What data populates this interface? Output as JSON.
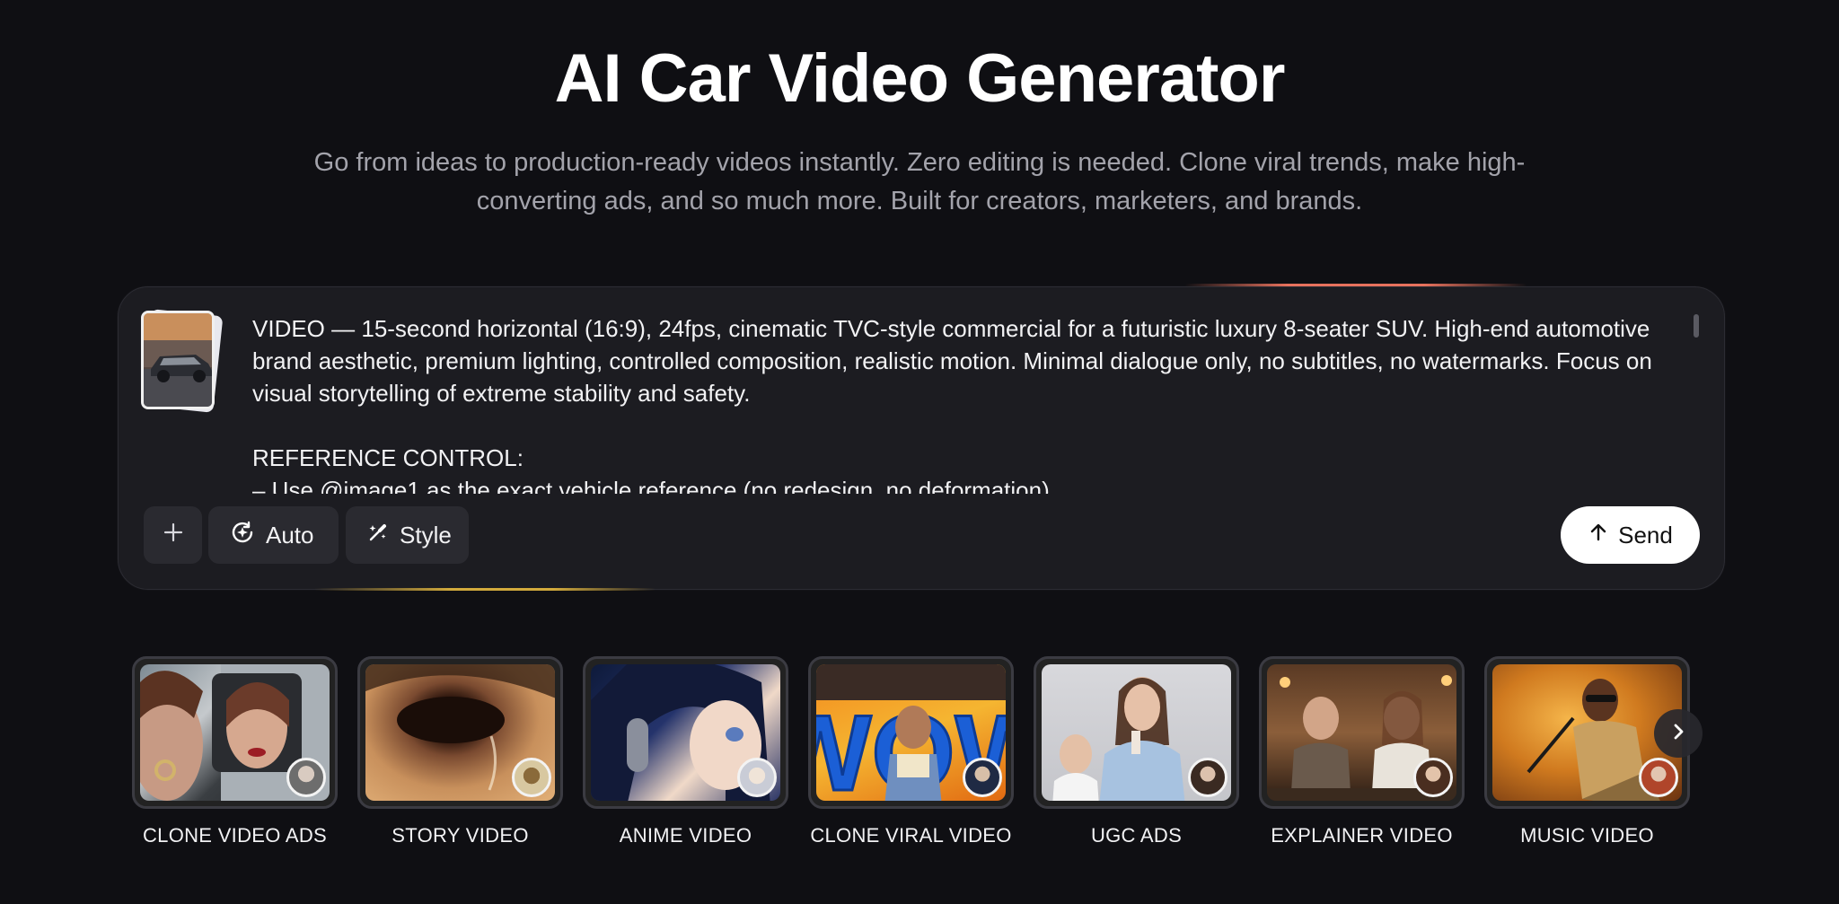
{
  "hero": {
    "title": "AI Car Video Generator",
    "subtitle": "Go from ideas to production-ready videos instantly. Zero editing is needed. Clone viral trends, make high-converting ads, and so much more. Built for creators, marketers, and brands."
  },
  "prompt": {
    "text": "VIDEO — 15-second horizontal (16:9), 24fps, cinematic TVC-style commercial for a futuristic luxury 8-seater SUV. High-end automotive brand aesthetic, premium lighting, controlled composition, realistic motion. Minimal dialogue only, no subtitles, no watermarks. Focus on visual storytelling of extreme stability and safety.\n\nREFERENCE CONTROL:\n– Use @image1 as the exact vehicle reference (no redesign, no deformation)"
  },
  "toolbar": {
    "add_icon": "plus-icon",
    "auto_label": "Auto",
    "auto_icon": "auto-sparkle-icon",
    "style_label": "Style",
    "style_icon": "brush-sparkle-icon",
    "send_label": "Send",
    "send_icon": "arrow-up-icon"
  },
  "templates": [
    {
      "label": "CLONE VIDEO ADS"
    },
    {
      "label": "STORY VIDEO"
    },
    {
      "label": "ANIME VIDEO"
    },
    {
      "label": "CLONE VIRAL VIDEO",
      "art_text": "WOW"
    },
    {
      "label": "UGC ADS"
    },
    {
      "label": "EXPLAINER VIDEO"
    },
    {
      "label": "MUSIC VIDEO"
    }
  ],
  "carousel": {
    "next_icon": "chevron-right-icon"
  },
  "colors": {
    "background": "#0f0f13",
    "card": "#1c1c21",
    "button": "#2a2a30",
    "send": "#ffffff",
    "glow_top": "#e7715c",
    "glow_bottom": "#d2aa3c"
  }
}
